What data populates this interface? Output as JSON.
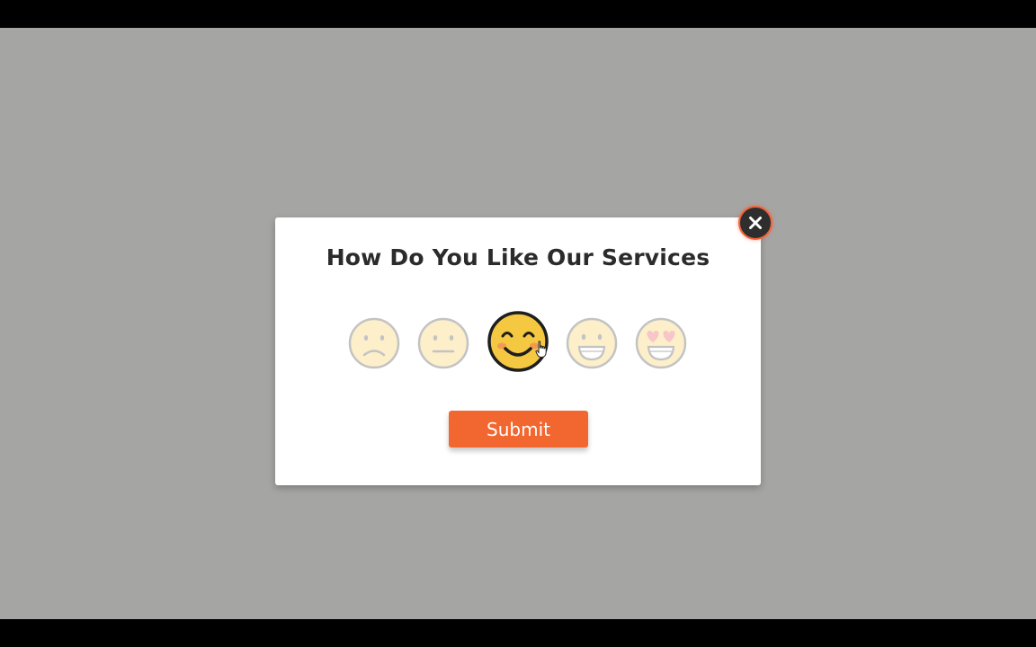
{
  "dialog": {
    "title": "How Do You Like Our Services",
    "submit_label": "Submit",
    "close_icon": "close-icon"
  },
  "rating": {
    "options": [
      {
        "icon": "sad-face-icon",
        "selected": false
      },
      {
        "icon": "neutral-face-icon",
        "selected": false
      },
      {
        "icon": "smiling-blush-face-icon",
        "selected": true
      },
      {
        "icon": "grinning-face-icon",
        "selected": false
      },
      {
        "icon": "heart-eyes-face-icon",
        "selected": false
      }
    ],
    "selected_index": 2
  },
  "colors": {
    "backdrop": "#a5a5a4",
    "accent": "#f2662f",
    "close_button_bg": "#2e2e2e",
    "emoji_yellow": "#f5c842",
    "title_text": "#2b2b2b"
  }
}
